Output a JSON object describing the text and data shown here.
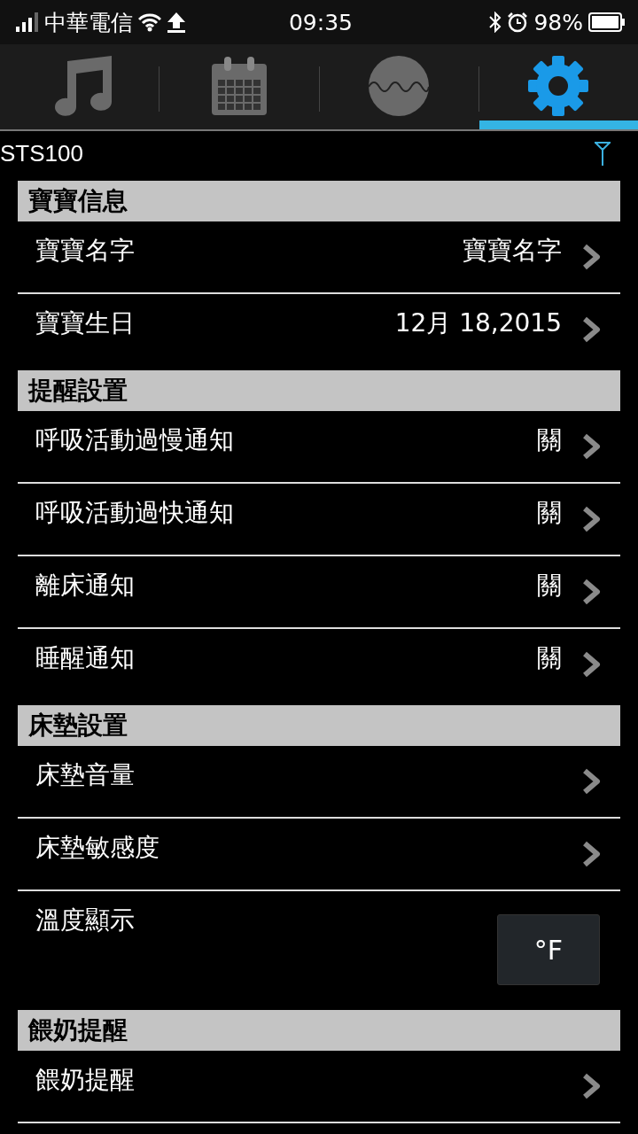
{
  "status_bar": {
    "carrier": "中華電信",
    "time": "09:35",
    "battery": "98%"
  },
  "tabs": [
    {
      "kind": "music",
      "selected": false
    },
    {
      "kind": "calendar",
      "selected": false
    },
    {
      "kind": "wave",
      "selected": false
    },
    {
      "kind": "settings",
      "selected": true
    }
  ],
  "device": {
    "name": "STS100"
  },
  "sections": [
    {
      "title": "寶寶信息",
      "items": [
        {
          "kind": "link",
          "label": "寶寶名字",
          "value": "寶寶名字"
        },
        {
          "kind": "link",
          "label": "寶寶生日",
          "value": "12月 18,2015"
        }
      ]
    },
    {
      "title": "提醒設置",
      "items": [
        {
          "kind": "link",
          "label": "呼吸活動過慢通知",
          "value": "關"
        },
        {
          "kind": "link",
          "label": "呼吸活動過快通知",
          "value": "關"
        },
        {
          "kind": "link",
          "label": "離床通知",
          "value": "關"
        },
        {
          "kind": "link",
          "label": "睡醒通知",
          "value": "關"
        }
      ]
    },
    {
      "title": "床墊設置",
      "items": [
        {
          "kind": "link",
          "label": "床墊音量"
        },
        {
          "kind": "link",
          "label": "床墊敏感度"
        },
        {
          "kind": "toggle",
          "label": "溫度顯示",
          "button": "°F"
        }
      ]
    },
    {
      "title": "餵奶提醒",
      "items": [
        {
          "kind": "link",
          "label": "餵奶提醒"
        }
      ]
    }
  ]
}
